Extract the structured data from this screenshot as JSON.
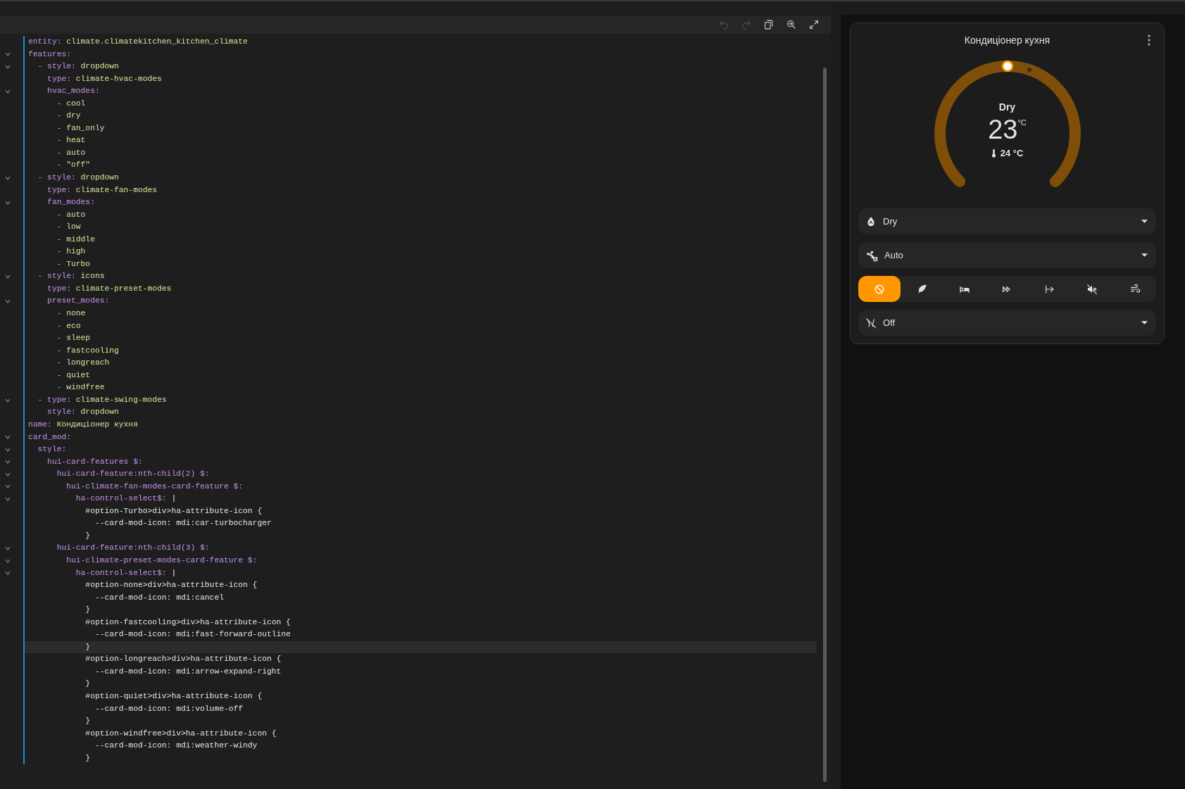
{
  "editor": {
    "toolbar": [
      {
        "disabled": true
      },
      {
        "disabled": true
      },
      {
        "disabled": false
      },
      {
        "disabled": false
      },
      {
        "disabled": false
      }
    ],
    "lines": [
      {
        "fold": false,
        "current": false,
        "key": "entity:",
        "value": " climate.climatekitchen_kitchen_climate"
      },
      {
        "fold": true,
        "current": false,
        "key": "features:"
      },
      {
        "fold": true,
        "current": false,
        "key": "  - style:",
        "value": " dropdown"
      },
      {
        "fold": false,
        "current": false,
        "key": "    type:",
        "value": " climate-hvac-modes"
      },
      {
        "fold": true,
        "current": false,
        "key": "    hvac_modes:"
      },
      {
        "fold": false,
        "current": false,
        "key": "      -",
        "value": " cool"
      },
      {
        "fold": false,
        "current": false,
        "key": "      -",
        "value": " dry"
      },
      {
        "fold": false,
        "current": false,
        "key": "      -",
        "value": " fan_only"
      },
      {
        "fold": false,
        "current": false,
        "key": "      -",
        "value": " heat"
      },
      {
        "fold": false,
        "current": false,
        "key": "      -",
        "value": " auto"
      },
      {
        "fold": false,
        "current": false,
        "key": "      -",
        "value": " \"off\""
      },
      {
        "fold": true,
        "current": false,
        "key": "  - style:",
        "value": " dropdown"
      },
      {
        "fold": false,
        "current": false,
        "key": "    type:",
        "value": " climate-fan-modes"
      },
      {
        "fold": true,
        "current": false,
        "key": "    fan_modes:"
      },
      {
        "fold": false,
        "current": false,
        "key": "      -",
        "value": " auto"
      },
      {
        "fold": false,
        "current": false,
        "key": "      -",
        "value": " low"
      },
      {
        "fold": false,
        "current": false,
        "key": "      -",
        "value": " middle"
      },
      {
        "fold": false,
        "current": false,
        "key": "      -",
        "value": " high"
      },
      {
        "fold": false,
        "current": false,
        "key": "      -",
        "value": " Turbo"
      },
      {
        "fold": true,
        "current": false,
        "key": "  - style:",
        "value": " icons"
      },
      {
        "fold": false,
        "current": false,
        "key": "    type:",
        "value": " climate-preset-modes"
      },
      {
        "fold": true,
        "current": false,
        "key": "    preset_modes:"
      },
      {
        "fold": false,
        "current": false,
        "key": "      -",
        "value": " none"
      },
      {
        "fold": false,
        "current": false,
        "key": "      -",
        "value": " eco"
      },
      {
        "fold": false,
        "current": false,
        "key": "      -",
        "value": " sleep"
      },
      {
        "fold": false,
        "current": false,
        "key": "      -",
        "value": " fastcooling"
      },
      {
        "fold": false,
        "current": false,
        "key": "      -",
        "value": " longreach"
      },
      {
        "fold": false,
        "current": false,
        "key": "      -",
        "value": " quiet"
      },
      {
        "fold": false,
        "current": false,
        "key": "      -",
        "value": " windfree"
      },
      {
        "fold": true,
        "current": false,
        "key": "  - type:",
        "value": " climate-swing-modes"
      },
      {
        "fold": false,
        "current": false,
        "key": "    style:",
        "value": " dropdown"
      },
      {
        "fold": false,
        "current": false,
        "key": "name:",
        "value": " Кондиціонер кухня"
      },
      {
        "fold": true,
        "current": false,
        "key": "card_mod:"
      },
      {
        "fold": true,
        "current": false,
        "key": "  style:"
      },
      {
        "fold": true,
        "current": false,
        "key": "    hui-card-features $:"
      },
      {
        "fold": true,
        "current": false,
        "key": "      hui-card-feature:nth-child(2) $:"
      },
      {
        "fold": true,
        "current": false,
        "key": "        hui-climate-fan-modes-card-feature $:"
      },
      {
        "fold": true,
        "current": false,
        "key": "          ha-control-select$:",
        "text": " |"
      },
      {
        "fold": false,
        "current": false,
        "text": "            #option-Turbo>div>ha-attribute-icon {"
      },
      {
        "fold": false,
        "current": false,
        "text": "              --card-mod-icon: mdi:car-turbocharger"
      },
      {
        "fold": false,
        "current": false,
        "text": "            }"
      },
      {
        "fold": true,
        "current": false,
        "key": "      hui-card-feature:nth-child(3) $:"
      },
      {
        "fold": true,
        "current": false,
        "key": "        hui-climate-preset-modes-card-feature $:"
      },
      {
        "fold": true,
        "current": false,
        "key": "          ha-control-select$:",
        "text": " |"
      },
      {
        "fold": false,
        "current": false,
        "text": "            #option-none>div>ha-attribute-icon {"
      },
      {
        "fold": false,
        "current": false,
        "text": "              --card-mod-icon: mdi:cancel"
      },
      {
        "fold": false,
        "current": false,
        "text": "            }"
      },
      {
        "fold": false,
        "current": false,
        "text": "            #option-fastcooling>div>ha-attribute-icon {"
      },
      {
        "fold": false,
        "current": false,
        "text": "              --card-mod-icon: mdi:fast-forward-outline"
      },
      {
        "fold": false,
        "current": true,
        "text": "            }"
      },
      {
        "fold": false,
        "current": false,
        "text": "            #option-longreach>div>ha-attribute-icon {"
      },
      {
        "fold": false,
        "current": false,
        "text": "              --card-mod-icon: mdi:arrow-expand-right"
      },
      {
        "fold": false,
        "current": false,
        "text": "            }"
      },
      {
        "fold": false,
        "current": false,
        "text": "            #option-quiet>div>ha-attribute-icon {"
      },
      {
        "fold": false,
        "current": false,
        "text": "              --card-mod-icon: mdi:volume-off"
      },
      {
        "fold": false,
        "current": false,
        "text": "            }"
      },
      {
        "fold": false,
        "current": false,
        "text": "            #option-windfree>div>ha-attribute-icon {"
      },
      {
        "fold": false,
        "current": false,
        "text": "              --card-mod-icon: mdi:weather-windy"
      },
      {
        "fold": false,
        "current": false,
        "text": "            }"
      }
    ]
  },
  "card": {
    "title": "Кондиціонер кухня",
    "gauge": {
      "mode": "Dry",
      "target": "23",
      "unit": "°C",
      "current": "24 °C"
    },
    "hvac_select": {
      "value": "Dry"
    },
    "fan_select": {
      "value": "Auto"
    },
    "presets": [
      {
        "selected": true
      },
      {
        "selected": false
      },
      {
        "selected": false
      },
      {
        "selected": false
      },
      {
        "selected": false
      },
      {
        "selected": false
      },
      {
        "selected": false
      }
    ],
    "swing_select": {
      "value": "Off"
    }
  }
}
